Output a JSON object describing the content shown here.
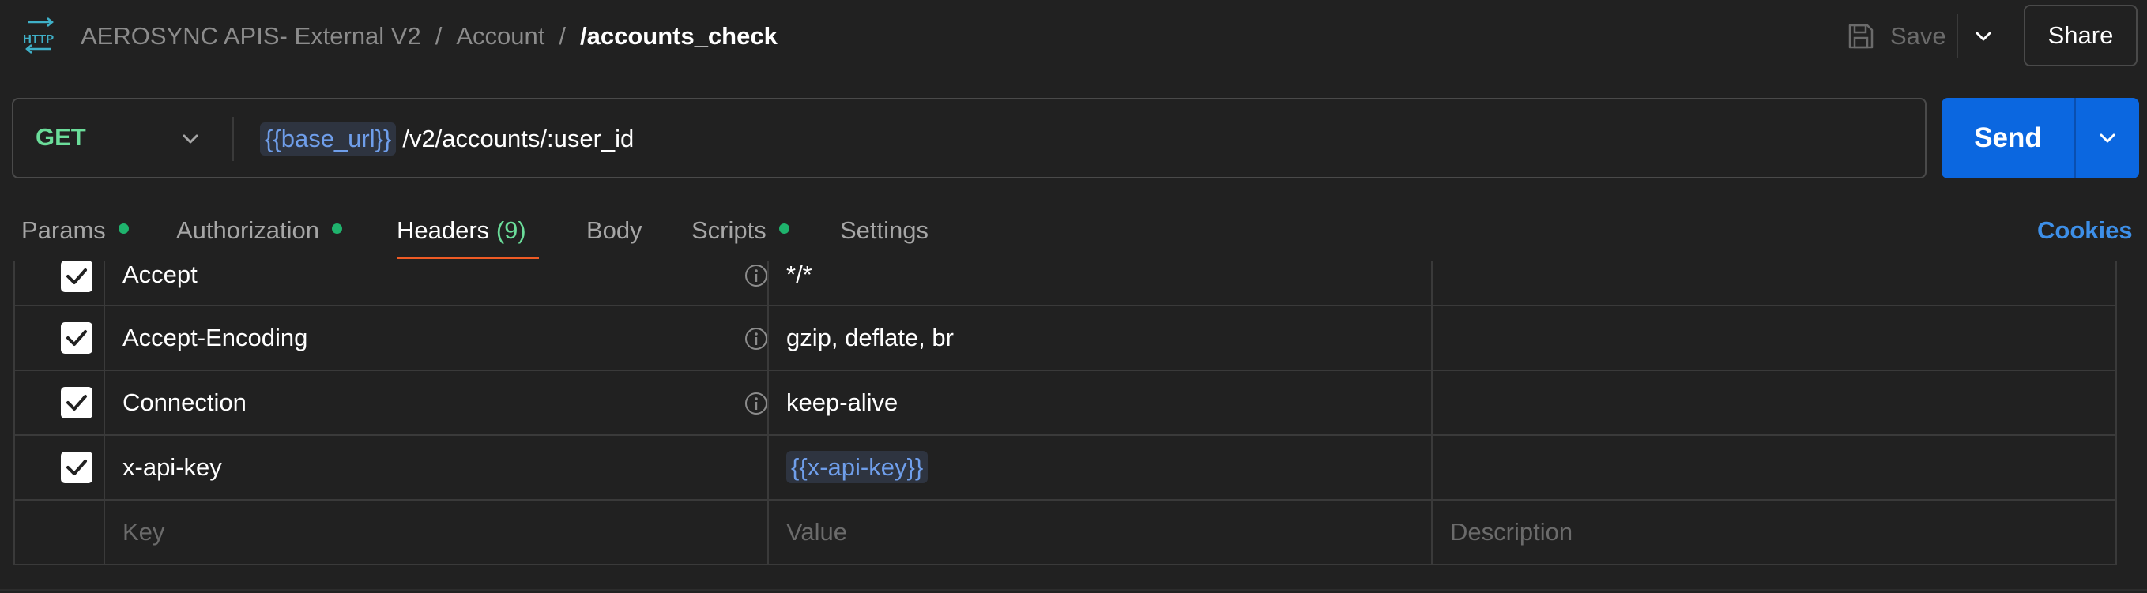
{
  "breadcrumb": {
    "collection": "AEROSYNC APIS- External V2",
    "folder": "Account",
    "request": "/accounts_check",
    "separator": "/"
  },
  "toolbar": {
    "save_label": "Save",
    "share_label": "Share"
  },
  "request": {
    "method": "GET",
    "url_variable": "{{base_url}}",
    "url_path": "/v2/accounts/:user_id",
    "send_label": "Send"
  },
  "tabs": [
    {
      "label": "Params",
      "has_dot": true
    },
    {
      "label": "Authorization",
      "has_dot": true
    },
    {
      "label": "Headers",
      "count": "(9)",
      "active": true
    },
    {
      "label": "Body"
    },
    {
      "label": "Scripts",
      "has_dot": true
    },
    {
      "label": "Settings"
    }
  ],
  "cookies_label": "Cookies",
  "headers_table": {
    "rows": [
      {
        "checked": true,
        "key": "Accept",
        "value": "*/*",
        "info": true
      },
      {
        "checked": true,
        "key": "Accept-Encoding",
        "value": "gzip, deflate, br",
        "info": true
      },
      {
        "checked": true,
        "key": "Connection",
        "value": "keep-alive",
        "info": true
      },
      {
        "checked": true,
        "key": "x-api-key",
        "value": "{{x-api-key}}",
        "info": false
      }
    ],
    "placeholders": {
      "key": "Key",
      "value": "Value",
      "description": "Description"
    }
  },
  "colors": {
    "background": "#212121",
    "method_get": "#6bdd9a",
    "send_button": "#0b67e0",
    "active_tab_underline": "#ef5b25",
    "status_dot": "#1fb36d",
    "variable_text": "#6f9eea",
    "cookies_link": "#3d8fe8"
  },
  "icons": {
    "app_icon": "http-icon",
    "save_icon": "save-icon",
    "info_icon": "info-icon",
    "checkbox": "checkbox-checked-icon"
  }
}
